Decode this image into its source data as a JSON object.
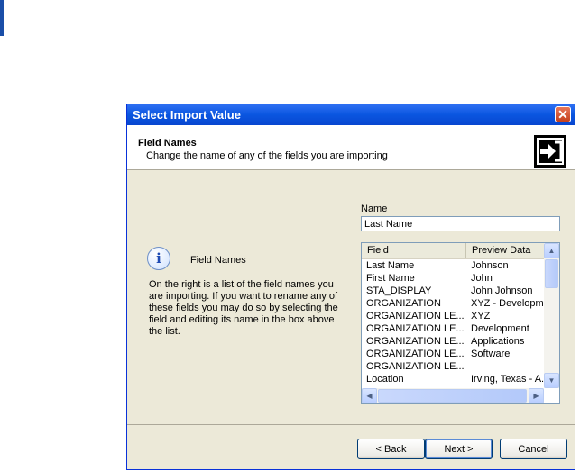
{
  "dialog": {
    "title": "Select Import Value",
    "close_symbol": "✕",
    "header": {
      "title": "Field Names",
      "subtitle": "Change the name of any of the fields you are importing",
      "icon": "import-arrow-icon"
    },
    "info": {
      "icon": "info-icon",
      "icon_glyph": "i",
      "title": "Field Names",
      "description": "On the right is a list of the field names you are importing. If you want to rename any of these fields you may do so by selecting the field and editing its name in the box above the list."
    },
    "name_field": {
      "label": "Name",
      "value": "Last Name"
    },
    "list": {
      "columns": [
        "Field",
        "Preview Data"
      ],
      "rows": [
        {
          "field": "Last Name",
          "preview": "Johnson"
        },
        {
          "field": "First Name",
          "preview": "John"
        },
        {
          "field": "STA_DISPLAY",
          "preview": "John Johnson"
        },
        {
          "field": "ORGANIZATION",
          "preview": "XYZ - Developm"
        },
        {
          "field": "ORGANIZATION LE...",
          "preview": "XYZ"
        },
        {
          "field": "ORGANIZATION LE...",
          "preview": "Development"
        },
        {
          "field": "ORGANIZATION LE...",
          "preview": "Applications"
        },
        {
          "field": "ORGANIZATION LE...",
          "preview": "Software"
        },
        {
          "field": "ORGANIZATION LE...",
          "preview": ""
        },
        {
          "field": "Location",
          "preview": "Irving, Texas - A..."
        }
      ],
      "scroll_up": "▲",
      "scroll_down": "▼",
      "scroll_left": "◀",
      "scroll_right": "▶"
    },
    "buttons": {
      "back": "< Back",
      "next": "Next >",
      "cancel": "Cancel"
    },
    "colors": {
      "titlebar": "#0a56e0",
      "dialog_bg": "#ece9d8",
      "accent": "#1a4ea8"
    }
  }
}
